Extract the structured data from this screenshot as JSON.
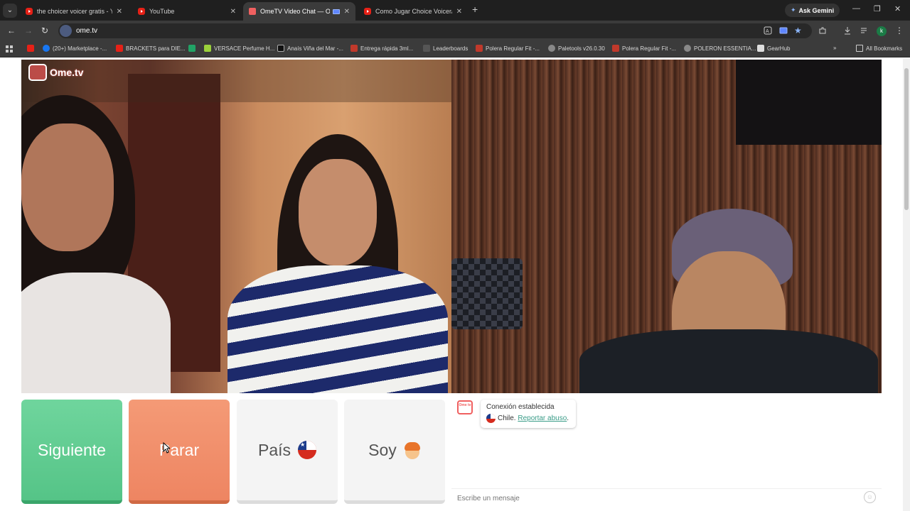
{
  "browser": {
    "tabs": [
      {
        "label": "the choicer voicer gratis - Y",
        "favicon": "youtube-icon",
        "active": false
      },
      {
        "label": "YouTube",
        "favicon": "youtube-icon",
        "active": false
      },
      {
        "label": "OmeTV Video Chat — Ome",
        "favicon": "ometv-icon",
        "active": true
      },
      {
        "label": "Como Jugar Choice Voicer/Tuto",
        "favicon": "youtube-icon",
        "active": false
      }
    ],
    "gemini_label": "Ask Gemini",
    "url": "ome.tv",
    "profile_initial": "k",
    "bookmarks": [
      {
        "label": "",
        "icon": "youtube-icon",
        "color": "#e62117"
      },
      {
        "label": "(20+) Marketplace -...",
        "icon": "facebook-icon",
        "color": "#1877f2"
      },
      {
        "label": "BRACKETS para DIE...",
        "icon": "youtube-icon",
        "color": "#e62117"
      },
      {
        "label": "",
        "icon": "sheet-icon",
        "color": "#21a366"
      },
      {
        "label": "VERSACE Perfume H...",
        "icon": "store-icon",
        "color": "#9bd13b"
      },
      {
        "label": "Anaís Viña del Mar -...",
        "icon": "store-icon",
        "color": "#111111"
      },
      {
        "label": "Entrega rápida 3ml...",
        "icon": "store-icon",
        "color": "#c0392b"
      },
      {
        "label": "Leaderboards",
        "icon": "game-icon",
        "color": "#555555"
      },
      {
        "label": "Polera Regular Fit -...",
        "icon": "store-icon",
        "color": "#c0392b"
      },
      {
        "label": "Paletools v26.0.30",
        "icon": "globe-icon",
        "color": "#888888"
      },
      {
        "label": "Polera Regular Fit -...",
        "icon": "store-icon",
        "color": "#c0392b"
      },
      {
        "label": "POLERON ESSENTIA...",
        "icon": "globe-icon",
        "color": "#888888"
      },
      {
        "label": "GearHub",
        "icon": "gear-hub-icon",
        "color": "#dddddd"
      }
    ],
    "all_bookmarks": "All Bookmarks"
  },
  "page": {
    "logo_text": "Ome.tv",
    "buttons": {
      "next": "Siguiente",
      "stop": "Parar",
      "country": "País",
      "gender": "Soy"
    },
    "chat": {
      "logo_text": "Ome tv",
      "status_title": "Conexión establecida",
      "country": "Chile.",
      "report_link": "Reportar abuso",
      "report_suffix": ".",
      "input_placeholder": "Escribe un mensaje"
    }
  },
  "colors": {
    "next_button": "#5fcb90",
    "stop_button": "#f08f6a",
    "accent_link": "#3a9c88",
    "brand_red": "#f06060"
  }
}
